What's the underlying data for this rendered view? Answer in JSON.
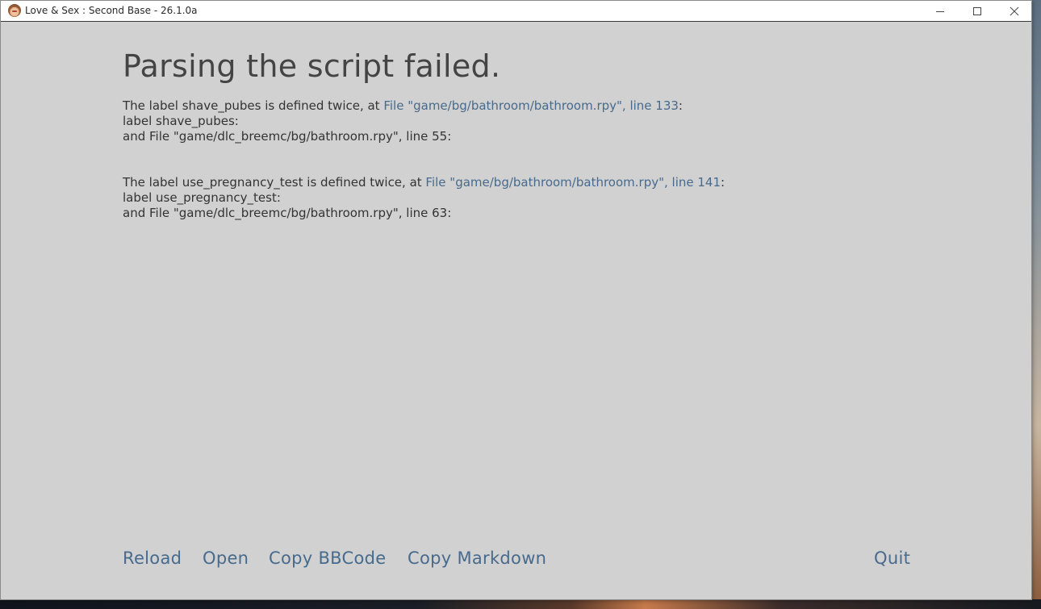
{
  "window": {
    "title": "Love & Sex : Second Base - 26.1.0a",
    "icon": "app-avatar-icon",
    "controls": {
      "minimize": "minimize-icon",
      "maximize": "maximize-icon",
      "close": "close-icon"
    }
  },
  "main": {
    "heading": "Parsing the script failed.",
    "errors": [
      {
        "prefix": "The label shave_pubes is defined twice, at ",
        "link": "File \"game/bg/bathroom/bathroom.rpy\", line 133",
        "suffix": ":",
        "code_line": "label shave_pubes:",
        "and_line": "and File \"game/dlc_breemc/bg/bathroom.rpy\", line 55:"
      },
      {
        "prefix": "The label use_pregnancy_test is defined twice, at ",
        "link": "File \"game/bg/bathroom/bathroom.rpy\", line 141",
        "suffix": ":",
        "code_line": "label use_pregnancy_test:",
        "and_line": "and File \"game/dlc_breemc/bg/bathroom.rpy\", line 63:"
      }
    ]
  },
  "footer": {
    "reload": "Reload",
    "open": "Open",
    "copy_bbcode": "Copy BBCode",
    "copy_markdown": "Copy Markdown",
    "quit": "Quit"
  },
  "colors": {
    "background": "#d1d1d1",
    "heading": "#444444",
    "text": "#333333",
    "link": "#476a8d",
    "titlebar": "#ffffff"
  }
}
